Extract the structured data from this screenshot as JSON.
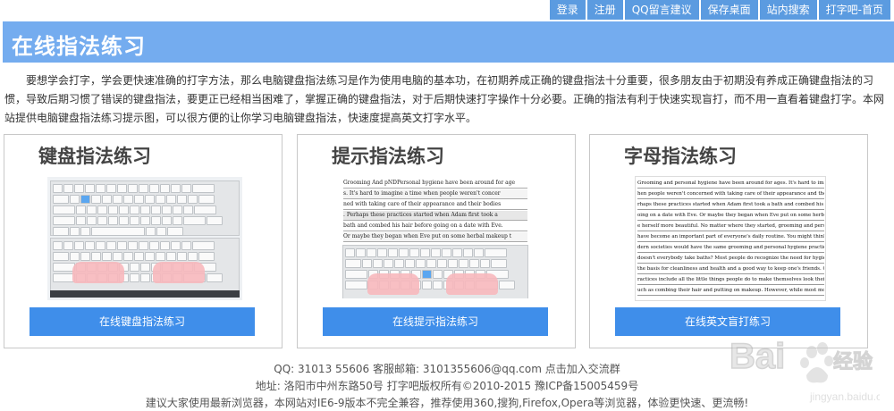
{
  "topnav": [
    "登录",
    "注册",
    "QQ留言建议",
    "保存桌面",
    "站内搜索",
    "打字吧-首页"
  ],
  "banner_title": "在线指法练习",
  "intro": "要想学会打字，学会更快速准确的打字方法，那么电脑键盘指法练习是作为使用电脑的基本功，在初期养成正确的键盘指法十分重要，很多朋友由于初期没有养成正确键盘指法的习惯，导致后期习惯了错误的键盘指法，要更正已经相当困难了，掌握正确的键盘指法，对于后期快速打字操作十分必要。正确的指法有利于快速实现盲打，而不用一直看着键盘打字。本网站提供电脑键盘指法练习提示图，可以很方便的让你学习电脑键盘指法，快速度提高英文打字水平。",
  "cards": [
    {
      "title": "键盘指法练习",
      "button": "在线键盘指法练习"
    },
    {
      "title": "提示指法练习",
      "button": "在线提示指法练习"
    },
    {
      "title": "字母指法练习",
      "button": "在线英文盲打练习"
    }
  ],
  "prompt_lines": [
    "Grooming And pNDPersonal hygiene have been around for age",
    "s. It's hard to imagine a time when people weren't concer",
    "ned with taking care of their appearance and their bodies",
    ". Perhaps these practices started when Adam first took a",
    "bath and combed his hair before going on a date with Eve.",
    "Or maybe they began when Eve put on some herbal makeup t"
  ],
  "english_lines": [
    "Grooming and personal hygiene have been around for ages. It's hard to imagine a time w",
    "hen people weren't concerned with taking care of their appearance and their bodies. Pe",
    "rhaps these practices started when Adam first took a bath and combed his hair before g",
    "oing on a date with Eve. Or maybe they began when Eve put on some herbal makeup to mak",
    "e herself more beautiful. No matter where they started, grooming and personal hygiene",
    "have become an important part of everyone's daily routine. You might think that all mo",
    "dern societies would have the same grooming and personal hygiene practices. After all,",
    "doesn't everybody take baths? Most people do recognize the need for hygiene, which is",
    "the basis for cleanliness and health and a good way to keep one's friends. Grooming p",
    "ractices include all the little things people do to make themselves look their best, s",
    "uch as combing their hair and putting on makeup. However, while most modern people agr"
  ],
  "footer": {
    "line1": "QQ: 31013 55606 客服邮箱: 3101355606@qq.com 点击加入交流群",
    "line2": "地址: 洛阳市中州东路50号 打字吧版权所有©2010-2015 豫ICP备15005459号",
    "line3": "建议大家使用最新浏览器，本网站对IE6-9版本不完全兼容，推荐使用360,搜狗,Firefox,Opera等浏览器，体验更快速、更流畅!"
  },
  "watermark": {
    "brand": "Baidu",
    "cn": "经验",
    "url": "jingyan.baidu.com"
  },
  "colors": {
    "banner": "#74acef",
    "nav": "#5b9be0",
    "button": "#3f8eea"
  }
}
